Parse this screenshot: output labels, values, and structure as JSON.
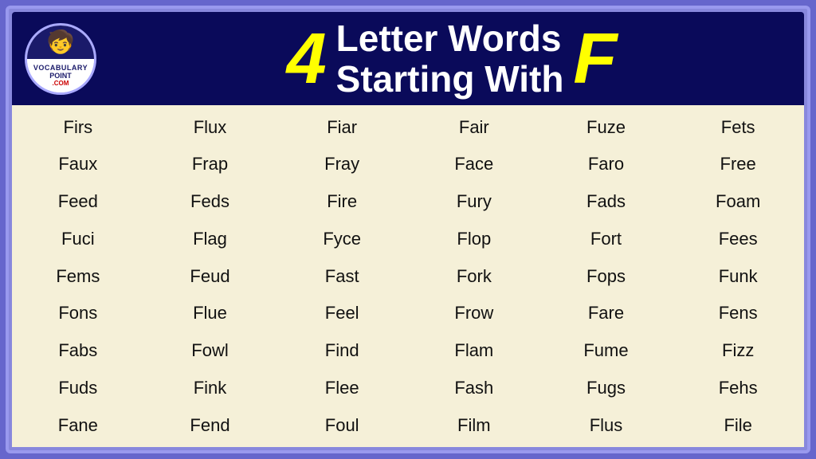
{
  "header": {
    "logo": {
      "top_text": "📚",
      "line1": "VOCABULARY",
      "line2": "POINT",
      "line3": ".COM"
    },
    "number": "4",
    "title_line1": "Letter Words",
    "title_line2": "Starting With",
    "letter": "F"
  },
  "words": [
    "Firs",
    "Flux",
    "Fiar",
    "Fair",
    "Fuze",
    "Fets",
    "Faux",
    "Frap",
    "Fray",
    "Face",
    "Faro",
    "Free",
    "Feed",
    "Feds",
    "Fire",
    "Fury",
    "Fads",
    "Foam",
    "Fuci",
    "Flag",
    "Fyce",
    "Flop",
    "Fort",
    "Fees",
    "Fems",
    "Feud",
    "Fast",
    "Fork",
    "Fops",
    "Funk",
    "Fons",
    "Flue",
    "Feel",
    "Frow",
    "Fare",
    "Fens",
    "Fabs",
    "Fowl",
    "Find",
    "Flam",
    "Fume",
    "Fizz",
    "Fuds",
    "Fink",
    "Flee",
    "Fash",
    "Fugs",
    "Fehs",
    "Fane",
    "Fend",
    "Foul",
    "Film",
    "Flus",
    "File"
  ]
}
